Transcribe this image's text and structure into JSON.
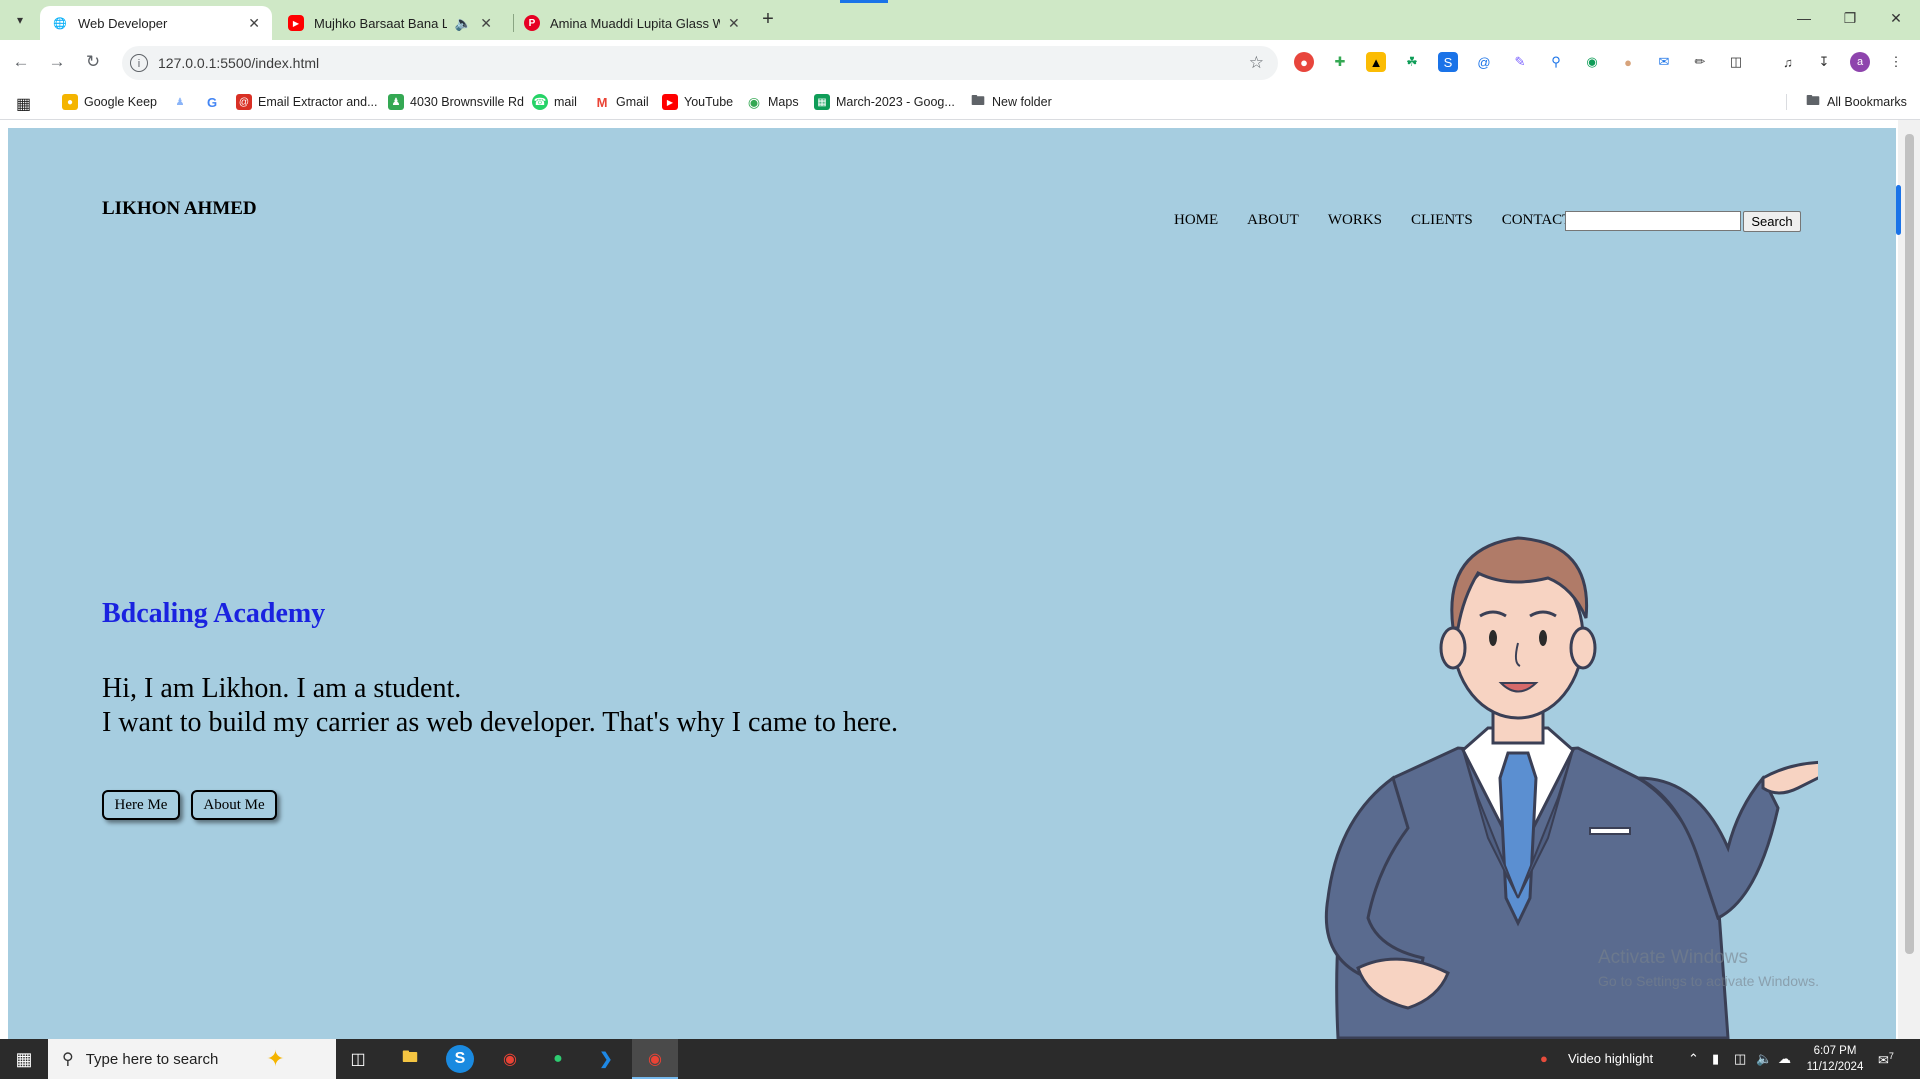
{
  "browser": {
    "tabs": [
      {
        "title": "Web Developer",
        "favicon": "globe-icon",
        "active": true
      },
      {
        "title": "Mujhko Barsaat Bana Lo Full",
        "favicon": "youtube-icon",
        "active": false,
        "audio": true
      },
      {
        "title": "Amina Muaddi Lupita Glass We",
        "favicon": "pinterest-icon",
        "active": false
      }
    ],
    "url": "127.0.0.1:5500/index.html",
    "bookmarks": [
      {
        "label": "Google Keep",
        "icon": "keep-icon",
        "color": "#f4b400"
      },
      {
        "label": "",
        "icon": "person-icon",
        "color": "#8ab4f8"
      },
      {
        "label": "",
        "icon": "google-icon",
        "color": "#4285f4"
      },
      {
        "label": "Email Extractor and...",
        "icon": "email-extractor-icon",
        "color": "#d93025"
      },
      {
        "label": "4030 Brownsville Rd",
        "icon": "group-icon",
        "color": "#34a853"
      },
      {
        "label": "mail",
        "icon": "whatsapp-icon",
        "color": "#25d366"
      },
      {
        "label": "Gmail",
        "icon": "gmail-icon",
        "color": "#ea4335"
      },
      {
        "label": "YouTube",
        "icon": "youtube-icon",
        "color": "#ff0000"
      },
      {
        "label": "Maps",
        "icon": "maps-icon",
        "color": "#34a853"
      },
      {
        "label": "March-2023 - Goog...",
        "icon": "sheets-icon",
        "color": "#0f9d58"
      },
      {
        "label": "New folder",
        "icon": "folder-icon",
        "color": "#5f6368"
      }
    ],
    "all_bookmarks": "All Bookmarks"
  },
  "page": {
    "logo": "LIKHON AHMED",
    "nav": [
      "HOME",
      "ABOUT",
      "WORKS",
      "CLIENTS",
      "CONTACT"
    ],
    "search_value": "",
    "search_button": "Search",
    "academy": "Bdcaling Academy",
    "intro_line1": "Hi, I am Likhon. I am a student.",
    "intro_line2": "I want to build my carrier as web developer. That's why I came to here.",
    "button1": "Here Me",
    "button2": "About Me",
    "background_color": "#a6cde0",
    "accent_color": "#1a22e0"
  },
  "windows": {
    "watermark_title": "Activate Windows",
    "watermark_sub": "Go to Settings to activate Windows.",
    "search_placeholder": "Type here to search",
    "tray_label": "Video highlight",
    "time": "6:07 PM",
    "date": "11/12/2024",
    "notifications": "7"
  }
}
